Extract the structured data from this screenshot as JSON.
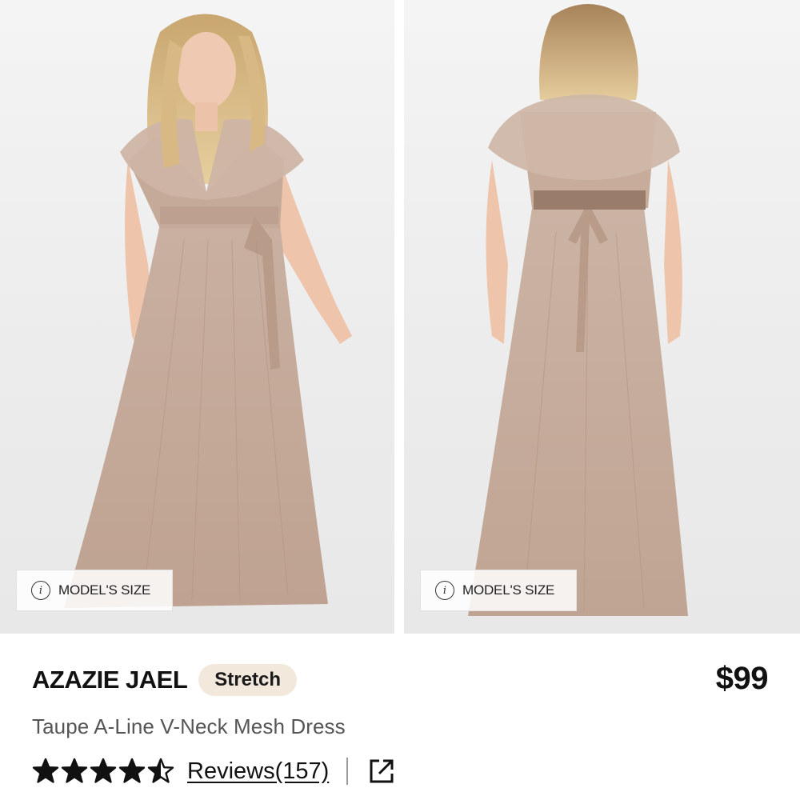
{
  "gallery": {
    "images": [
      {
        "view": "front",
        "model_size_label": "MODEL'S SIZE",
        "model_size_icon": "info-icon"
      },
      {
        "view": "back",
        "model_size_label": "MODEL'S SIZE",
        "model_size_icon": "info-icon"
      }
    ]
  },
  "product": {
    "brand": "AZAZIE JAEL",
    "badge": "Stretch",
    "price": "$99",
    "subtitle": "Taupe A-Line V-Neck Mesh Dress",
    "rating": 4.5,
    "rating_max": 5,
    "reviews_label": "Reviews(157)",
    "share_icon": "external-link-icon"
  },
  "colors": {
    "dress": "#c7ad9d",
    "badge_bg": "#f3e8dc",
    "text": "#111111",
    "muted_text": "#555555"
  }
}
